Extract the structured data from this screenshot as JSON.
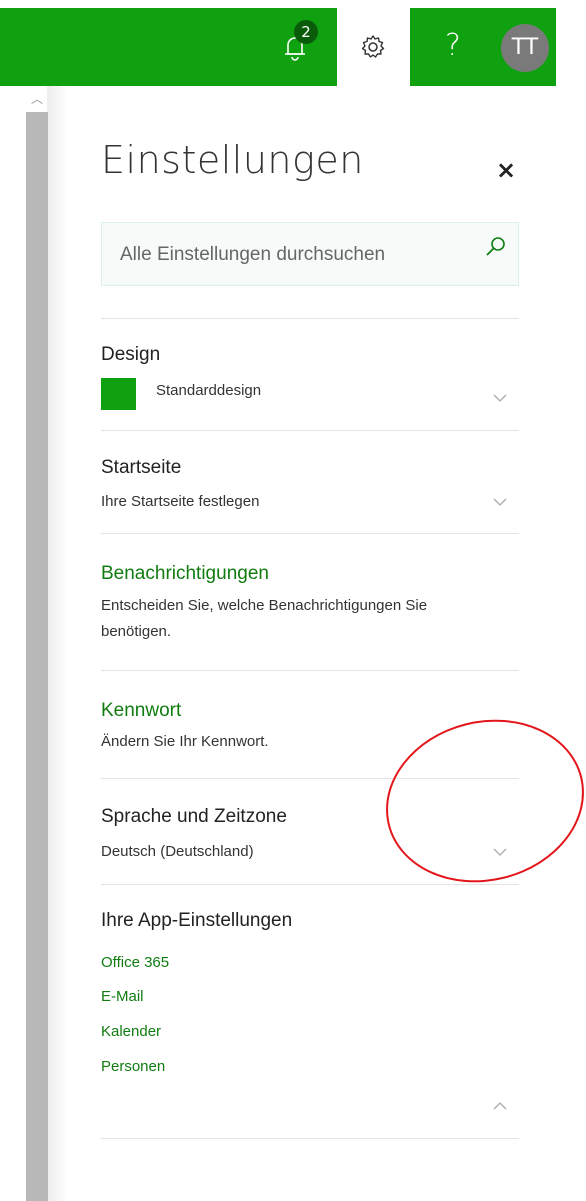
{
  "colors": {
    "brand_green": "#10a111",
    "link_green": "#107c10",
    "badge_bg": "#0a5c0a",
    "annotation_red": "#e3161b"
  },
  "topbar": {
    "notifications_count": "2",
    "notification_icon": "bell-icon",
    "settings_icon": "gear-icon",
    "help_label": "?",
    "avatar_initials": "TT"
  },
  "panel": {
    "title": "Einstellungen",
    "close_label": "×"
  },
  "search": {
    "placeholder": "Alle Einstellungen durchsuchen",
    "value": ""
  },
  "sections": {
    "design": {
      "title": "Design",
      "value": "Standarddesign"
    },
    "startseite": {
      "title": "Startseite",
      "value": "Ihre Startseite festlegen"
    },
    "benachrichtigungen": {
      "title": "Benachrichtigungen",
      "line1": "Entscheiden Sie, welche Benachrichtigungen Sie",
      "line2": "benötigen."
    },
    "kennwort": {
      "title": "Kennwort",
      "value": "Ändern Sie Ihr Kennwort."
    },
    "sprache": {
      "title": "Sprache und Zeitzone",
      "value": "Deutsch (Deutschland)"
    },
    "apps": {
      "title": "Ihre App-Einstellungen",
      "items": [
        "Office 365",
        "E-Mail",
        "Kalender",
        "Personen"
      ]
    }
  }
}
